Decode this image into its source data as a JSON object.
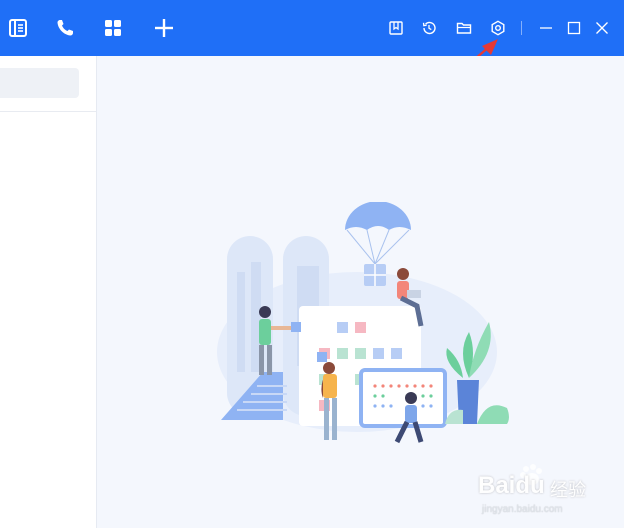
{
  "colors": {
    "titlebar": "#1f6ff7",
    "icon": "#ffffff",
    "background": "#f4f7fd",
    "sidebar": "#ffffff",
    "annotation_arrow": "#e53935"
  },
  "titlebar": {
    "left_icons": [
      "contacts-icon",
      "phone-icon",
      "apps-grid-icon",
      "plus-icon"
    ],
    "right_icons": [
      "bookmark-icon",
      "history-icon",
      "folder-icon",
      "settings-gear-icon"
    ],
    "window_controls": [
      "minimize-icon",
      "maximize-icon",
      "close-icon"
    ]
  },
  "sidebar": {
    "search": {
      "value": "",
      "placeholder": ""
    }
  },
  "watermark": {
    "brand": "Baidu",
    "cn": "经验",
    "url": "jingyan.baidu.com"
  }
}
